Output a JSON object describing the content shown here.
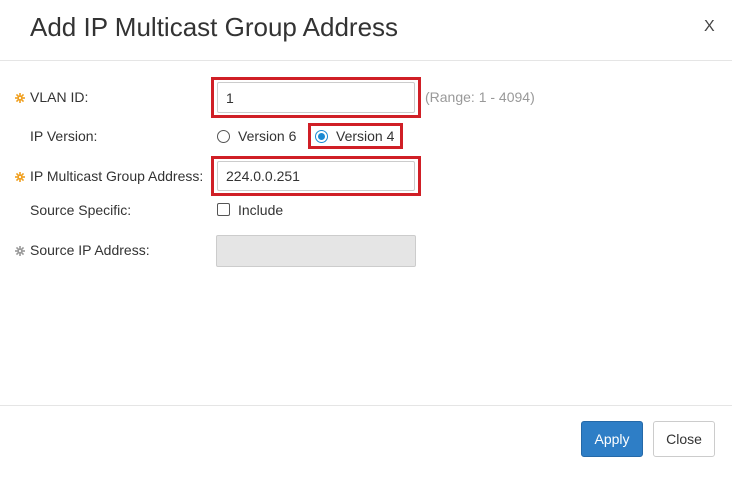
{
  "dialog": {
    "title": "Add IP Multicast Group Address",
    "close_label": "X"
  },
  "form": {
    "vlan_id": {
      "label": "VLAN ID:",
      "value": "1",
      "range_hint": "(Range: 1 - 4094)",
      "required": true
    },
    "ip_version": {
      "label": "IP Version:",
      "options": [
        {
          "label": "Version 6",
          "selected": false
        },
        {
          "label": "Version 4",
          "selected": true
        }
      ]
    },
    "ip_multicast_group_address": {
      "label": "IP Multicast Group Address:",
      "value": "224.0.0.251",
      "required": true
    },
    "source_specific": {
      "label": "Source Specific:",
      "checkbox_label": "Include",
      "checked": false
    },
    "source_ip_address": {
      "label": "Source IP Address:",
      "value": "",
      "disabled": true
    }
  },
  "footer": {
    "apply_label": "Apply",
    "close_label": "Close"
  },
  "colors": {
    "required_icon": "#f0a020",
    "disabled_icon": "#999999",
    "highlight": "#d01f26",
    "primary": "#2e7ec6",
    "radio_checked": "#1b8ad3"
  },
  "icons": {
    "required": "asterisk-gear-icon",
    "disabled": "asterisk-gear-icon"
  }
}
